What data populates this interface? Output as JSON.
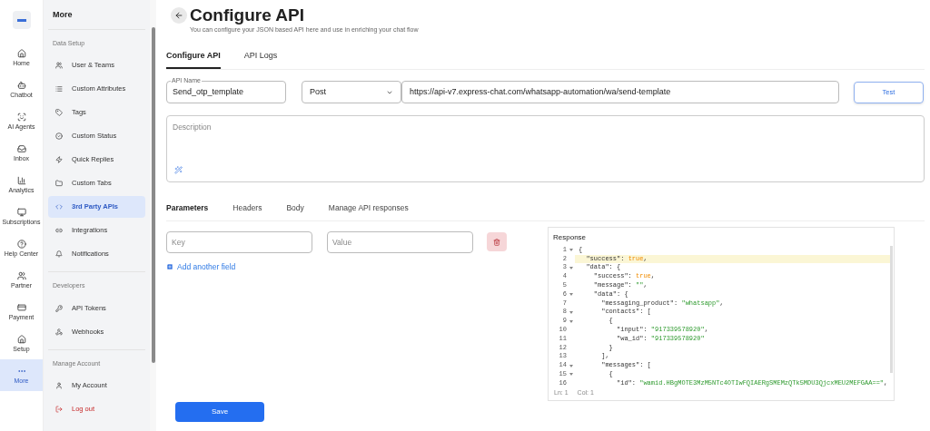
{
  "rail": [
    {
      "label": "Home",
      "selected": false
    },
    {
      "label": "Chatbot",
      "selected": false
    },
    {
      "label": "AI Agents",
      "selected": false
    },
    {
      "label": "Inbox",
      "selected": false
    },
    {
      "label": "Analytics",
      "selected": false
    },
    {
      "label": "Subscriptions",
      "selected": false
    },
    {
      "label": "Help Center",
      "selected": false
    },
    {
      "label": "Partner",
      "selected": false
    },
    {
      "label": "Payment",
      "selected": false
    },
    {
      "label": "Setup",
      "selected": false
    },
    {
      "label": "More",
      "selected": true
    }
  ],
  "sidebar": {
    "title": "More",
    "sections": [
      {
        "heading": "Data Setup",
        "items": [
          {
            "label": "User & Teams",
            "selected": false
          },
          {
            "label": "Custom Attributes",
            "selected": false
          },
          {
            "label": "Tags",
            "selected": false
          },
          {
            "label": "Custom Status",
            "selected": false
          },
          {
            "label": "Quick Replies",
            "selected": false
          },
          {
            "label": "Custom Tabs",
            "selected": false
          },
          {
            "label": "3rd Party APIs",
            "selected": true
          },
          {
            "label": "Integrations",
            "selected": false
          },
          {
            "label": "Notifications",
            "selected": false
          }
        ]
      },
      {
        "heading": "Developers",
        "items": [
          {
            "label": "API Tokens",
            "selected": false
          },
          {
            "label": "Webhooks",
            "selected": false
          }
        ]
      },
      {
        "heading": "Manage Account",
        "items": [
          {
            "label": "My Account",
            "selected": false
          },
          {
            "label": "Log out",
            "selected": false,
            "danger": true
          }
        ]
      }
    ]
  },
  "page": {
    "title": "Configure API",
    "subtitle": "You can configure your JSON based API here and use in enriching your chat flow"
  },
  "tabs": [
    {
      "label": "Configure API",
      "selected": true
    },
    {
      "label": "API Logs",
      "selected": false
    }
  ],
  "form": {
    "api_name": {
      "label": "API Name",
      "value": "Send_otp_template"
    },
    "method": "Post",
    "url": "https://api-v7.express-chat.com/whatsapp-automation/wa/send-template",
    "test_button": "Test",
    "description": {
      "placeholder": "Description"
    }
  },
  "param_tabs": [
    {
      "label": "Parameters",
      "selected": true
    },
    {
      "label": "Headers",
      "selected": false
    },
    {
      "label": "Body",
      "selected": false
    },
    {
      "label": "Manage API responses",
      "selected": false
    }
  ],
  "params": [
    {
      "key_placeholder": "Key",
      "value_placeholder": "Value"
    }
  ],
  "add_field": "Add another field",
  "response": {
    "title": "Response",
    "status": [
      "Ln: 1",
      "Col: 1"
    ],
    "lines": [
      {
        "num": "1",
        "fold": true,
        "highlighted": false,
        "tokens": [
          {
            "kind": "punct",
            "text": "{"
          }
        ]
      },
      {
        "num": "2",
        "fold": false,
        "highlighted": true,
        "tokens": [
          {
            "kind": "key",
            "text": "  \"success\""
          },
          {
            "kind": "punct",
            "text": ": "
          },
          {
            "kind": "bool",
            "text": "true"
          },
          {
            "kind": "punct",
            "text": ","
          }
        ]
      },
      {
        "num": "3",
        "fold": true,
        "highlighted": false,
        "tokens": [
          {
            "kind": "key",
            "text": "  \"data\""
          },
          {
            "kind": "punct",
            "text": ": {"
          }
        ]
      },
      {
        "num": "4",
        "fold": false,
        "highlighted": false,
        "tokens": [
          {
            "kind": "key",
            "text": "    \"success\""
          },
          {
            "kind": "punct",
            "text": ": "
          },
          {
            "kind": "bool",
            "text": "true"
          },
          {
            "kind": "punct",
            "text": ","
          }
        ]
      },
      {
        "num": "5",
        "fold": false,
        "highlighted": false,
        "tokens": [
          {
            "kind": "key",
            "text": "    \"message\""
          },
          {
            "kind": "punct",
            "text": ": "
          },
          {
            "kind": "string",
            "text": "\"\""
          },
          {
            "kind": "punct",
            "text": ","
          }
        ]
      },
      {
        "num": "6",
        "fold": true,
        "highlighted": false,
        "tokens": [
          {
            "kind": "key",
            "text": "    \"data\""
          },
          {
            "kind": "punct",
            "text": ": {"
          }
        ]
      },
      {
        "num": "7",
        "fold": false,
        "highlighted": false,
        "tokens": [
          {
            "kind": "key",
            "text": "      \"messaging_product\""
          },
          {
            "kind": "punct",
            "text": ": "
          },
          {
            "kind": "string",
            "text": "\"whatsapp\""
          },
          {
            "kind": "punct",
            "text": ","
          }
        ]
      },
      {
        "num": "8",
        "fold": true,
        "highlighted": false,
        "tokens": [
          {
            "kind": "key",
            "text": "      \"contacts\""
          },
          {
            "kind": "punct",
            "text": ": ["
          }
        ]
      },
      {
        "num": "9",
        "fold": true,
        "highlighted": false,
        "tokens": [
          {
            "kind": "punct",
            "text": "        {"
          }
        ]
      },
      {
        "num": "10",
        "fold": false,
        "highlighted": false,
        "tokens": [
          {
            "kind": "key",
            "text": "          \"input\""
          },
          {
            "kind": "punct",
            "text": ": "
          },
          {
            "kind": "string",
            "text": "\"917339578920\""
          },
          {
            "kind": "punct",
            "text": ","
          }
        ]
      },
      {
        "num": "11",
        "fold": false,
        "highlighted": false,
        "tokens": [
          {
            "kind": "key",
            "text": "          \"wa_id\""
          },
          {
            "kind": "punct",
            "text": ": "
          },
          {
            "kind": "string",
            "text": "\"917339578920\""
          }
        ]
      },
      {
        "num": "12",
        "fold": false,
        "highlighted": false,
        "tokens": [
          {
            "kind": "punct",
            "text": "        }"
          }
        ]
      },
      {
        "num": "13",
        "fold": false,
        "highlighted": false,
        "tokens": [
          {
            "kind": "punct",
            "text": "      ],"
          }
        ]
      },
      {
        "num": "14",
        "fold": true,
        "highlighted": false,
        "tokens": [
          {
            "kind": "key",
            "text": "      \"messages\""
          },
          {
            "kind": "punct",
            "text": ": ["
          }
        ]
      },
      {
        "num": "15",
        "fold": true,
        "highlighted": false,
        "tokens": [
          {
            "kind": "punct",
            "text": "        {"
          }
        ]
      },
      {
        "num": "16",
        "fold": false,
        "highlighted": false,
        "tokens": [
          {
            "kind": "key",
            "text": "          \"id\""
          },
          {
            "kind": "punct",
            "text": ": "
          },
          {
            "kind": "string",
            "text": "\"wamid.HBgMOTE3MzM5NTc4OTIwFQIAERgSMEMzQTk5MDU3QjcxMEU2MEFGAA==\""
          },
          {
            "kind": "punct",
            "text": ","
          }
        ]
      }
    ]
  },
  "save_button": "Save"
}
